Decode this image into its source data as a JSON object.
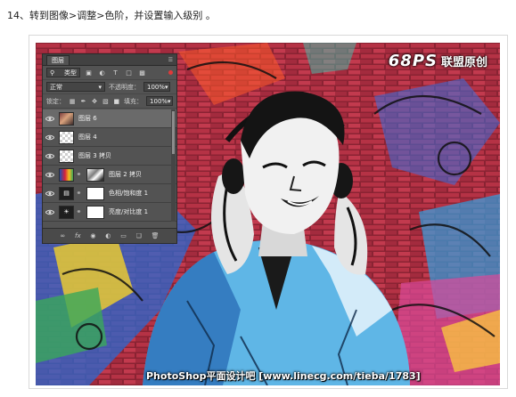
{
  "step_title": "14、转到图像>调整>色阶，并设置输入级别 。",
  "watermark": {
    "logo": "68PS",
    "text": "联盟原创"
  },
  "credit": "PhotoShop平面设计吧 [www.linecg.com/tieba/1783]",
  "layers_panel": {
    "tab_label": "图层",
    "filter_kind_label": "类型",
    "blend_mode": "正常",
    "opacity_label": "不透明度：",
    "opacity_value": "100%",
    "lock_label": "锁定：",
    "fill_label": "填充：",
    "fill_value": "100%",
    "selected_index": 0,
    "layers": [
      {
        "name": "图层 6",
        "thumb": "photo"
      },
      {
        "name": "图层 4",
        "thumb": "transparent"
      },
      {
        "name": "图层 3 拷贝",
        "thumb": "transparent"
      },
      {
        "name": "图层 2 拷贝",
        "thumb": "color"
      },
      {
        "name": "色相/饱和度 1",
        "thumb": "adjustment"
      },
      {
        "name": "亮度/对比度 1",
        "thumb": "adjustment"
      }
    ]
  },
  "colors": {
    "panel_bg": "#535353",
    "selected_layer": "#6a6a6a",
    "filter_indicator": "#e03a3a"
  }
}
